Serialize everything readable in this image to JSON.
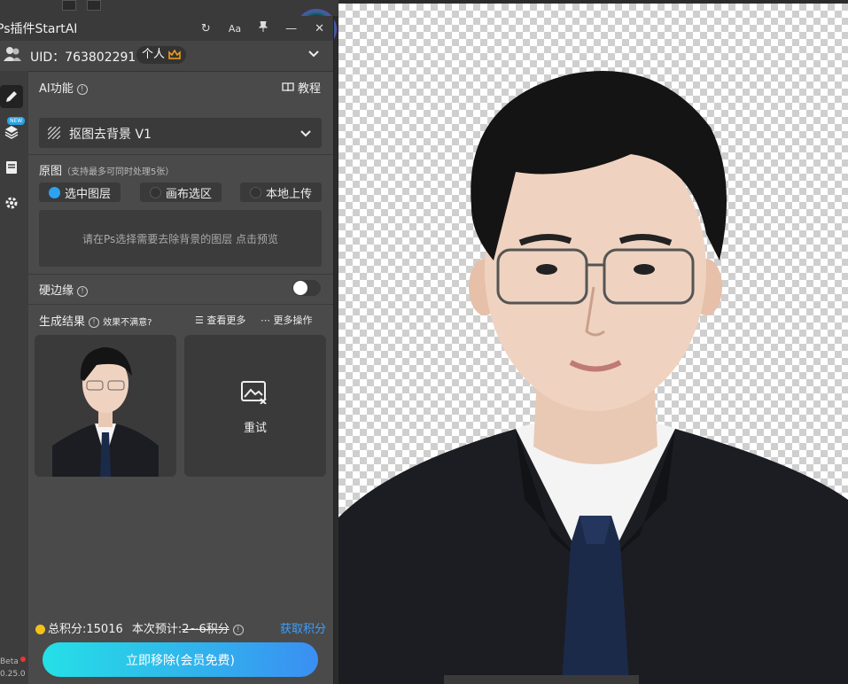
{
  "app": {
    "title": "Ps插件StartAI",
    "uid_label": "UID：763802291",
    "badge_label": "个人"
  },
  "sidebar": {
    "new_tag": "NEW",
    "version_lines": [
      "Beta",
      "0.25.0"
    ]
  },
  "ai_function": {
    "label": "AI功能",
    "tutorial_label": "教程",
    "selected_tool": "抠图去背景 V1"
  },
  "source": {
    "label": "原图",
    "hint": "（支持最多可同时处理5张）",
    "options": [
      {
        "label": "选中图层",
        "selected": true
      },
      {
        "label": "画布选区",
        "selected": false
      },
      {
        "label": "本地上传",
        "selected": false
      }
    ],
    "preview_text": "请在Ps选择需要去除背景的图层 点击预览"
  },
  "hard_edge": {
    "label": "硬边缘",
    "enabled": false
  },
  "results": {
    "label": "生成结果",
    "unsatisfied_label": "效果不满意?",
    "view_more_label": "查看更多",
    "more_ops_label": "更多操作",
    "retry_label": "重试"
  },
  "footer": {
    "total_points": "总积分:15016",
    "estimate_prefix": "本次预计:",
    "estimate_value": "2~6积分",
    "get_points_label": "获取积分",
    "cta_label": "立即移除(会员免费)"
  },
  "colors": {
    "accent_blue": "#2aa3f0",
    "link_blue": "#3aa0ff",
    "coin_gold": "#f2c21b",
    "cta_start": "#25e0e6",
    "cta_end": "#3a8ff2"
  }
}
